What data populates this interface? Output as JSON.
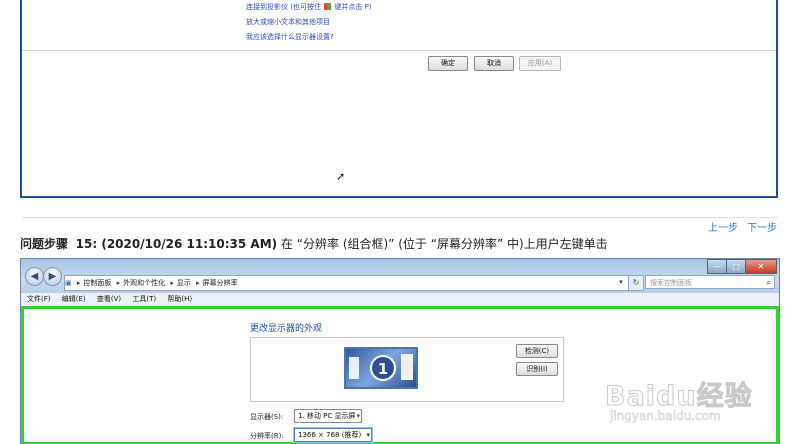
{
  "prev": {
    "links": [
      {
        "text": "连接到投影仪 (也可按住",
        "key_suffix": "键并点击 P)"
      },
      {
        "text": "放大或缩小文本和其他项目"
      },
      {
        "text": "我应该选择什么显示器设置?"
      }
    ],
    "buttons": {
      "ok": "确定",
      "cancel": "取消",
      "apply": "应用(A)"
    }
  },
  "nav": {
    "prev": "上一步",
    "next": "下一步"
  },
  "step": {
    "label": "问题步骤",
    "number": "15: (2020/10/26 11:10:35 AM)",
    "description": "在 “分辨率 (组合框)” (位于 “屏幕分辨率” 中)上用户左键单击"
  },
  "window": {
    "breadcrumb": [
      "控制面板",
      "外观和个性化",
      "显示",
      "屏幕分辨率"
    ],
    "search_placeholder": "搜索控制面板",
    "menu": [
      "文件(F)",
      "编辑(E)",
      "查看(V)",
      "工具(T)",
      "帮助(H)"
    ],
    "controls": {
      "min": "—",
      "max": "□",
      "close": "✕"
    }
  },
  "content": {
    "title": "更改显示器的外观",
    "monitor_number": "1",
    "detect_button": "检测(C)",
    "identify_button": "识别(I)",
    "display_label": "显示器(S):",
    "display_value": "1. 移动 PC 显示屏",
    "resolution_label": "分辨率(R):",
    "resolution_value": "1366 × 768 (推荐)"
  },
  "watermark": {
    "brand": "Baidu经验",
    "url": "jingyan.baidu.com"
  }
}
